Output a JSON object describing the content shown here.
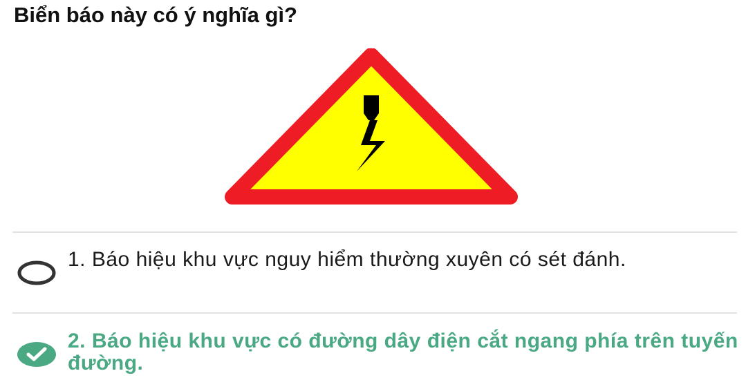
{
  "question": {
    "text": "Biển báo này có ý nghĩa gì?"
  },
  "sign": {
    "icon": "high-voltage-warning-sign",
    "border_color": "#ee1c25",
    "fill_color": "#ffff00",
    "symbol_color": "#000000"
  },
  "options": [
    {
      "number": "1.",
      "text": "1. Báo hiệu khu vực nguy hiểm thường xuyên có sét đánh.",
      "selected": false,
      "state_icon": "radio-unchecked-icon"
    },
    {
      "number": "2.",
      "text": "2. Báo hiệu khu vực có đường dây điện cắt ngang phía trên tuyến đường.",
      "selected": true,
      "state_icon": "check-circle-icon",
      "color": "#4aa883"
    }
  ]
}
